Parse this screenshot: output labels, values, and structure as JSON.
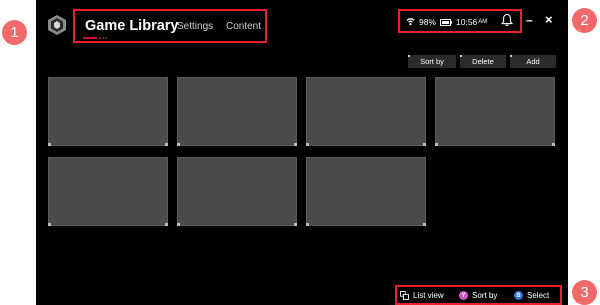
{
  "header": {
    "title": "Game Library",
    "tabs": [
      {
        "label": "Settings"
      },
      {
        "label": "Content"
      }
    ]
  },
  "status": {
    "battery": "98%",
    "time": "10:56",
    "ampm": "AM",
    "minimize": "–",
    "close": "×"
  },
  "toolbar": {
    "sort_label": "Sort by",
    "delete_label": "Delete",
    "add_label": "Add"
  },
  "footer": {
    "list_view": "List view",
    "sort_by": "Sort by",
    "sort_glyph": "Y",
    "select": "Select",
    "select_glyph": "B"
  },
  "callouts": [
    "1",
    "2",
    "3"
  ],
  "colors": {
    "background": "#000000",
    "tile": "#4a4a4a",
    "highlight_box": "#e8212b",
    "callout": "#f06a6a",
    "accent": "#e0003c",
    "y_button": "#d255c9",
    "b_button": "#2f6fd8"
  }
}
